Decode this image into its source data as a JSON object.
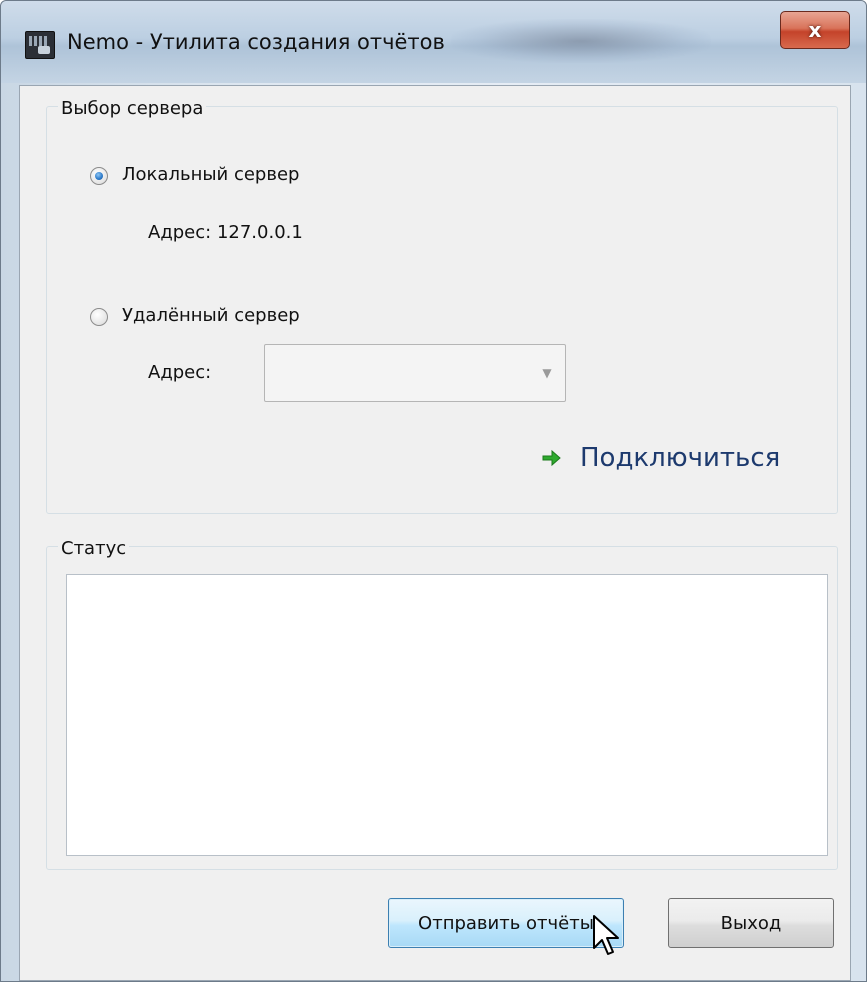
{
  "window": {
    "title": "Nemo - Утилита создания отчётов",
    "close_label": "x"
  },
  "server_group": {
    "legend": "Выбор сервера",
    "local": {
      "label": "Локальный сервер",
      "selected": true,
      "address": "Адрес: 127.0.0.1"
    },
    "remote": {
      "label": "Удалённый сервер",
      "selected": false,
      "address_label": "Адрес:",
      "address_value": ""
    },
    "connect_label": "Подключиться"
  },
  "status_group": {
    "legend": "Статус",
    "text": ""
  },
  "buttons": {
    "send": "Отправить отчёты",
    "exit": "Выход"
  },
  "colors": {
    "connect_arrow": "#2eaa2e",
    "close_button": "#c4432a"
  },
  "icons": [
    "app-icon",
    "close-icon",
    "radio-selected-icon",
    "radio-unselected-icon",
    "dropdown-arrow-icon",
    "arrow-right-icon",
    "mouse-cursor-icon"
  ]
}
